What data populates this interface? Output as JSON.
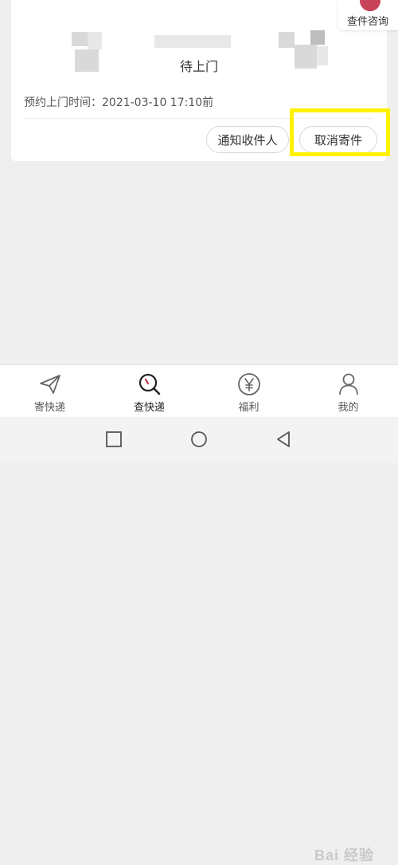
{
  "order": {
    "status": "待上门",
    "appointment": "预约上门时间：2021-03-10 17:10前"
  },
  "actions": {
    "notify_label": "通知收件人",
    "cancel_label": "取消寄件"
  },
  "consult": {
    "label": "查件咨询"
  },
  "tabs": [
    {
      "label": "寄快递",
      "icon": "paper-plane-icon",
      "active": false
    },
    {
      "label": "查快递",
      "icon": "magnifier-icon",
      "active": true
    },
    {
      "label": "福利",
      "icon": "yen-coin-icon",
      "active": false
    },
    {
      "label": "我的",
      "icon": "person-icon",
      "active": false
    }
  ],
  "system_nav": {
    "buttons": [
      "recent-apps-icon",
      "home-icon",
      "back-icon"
    ]
  },
  "watermark": {
    "text": "Bai 经验"
  },
  "colors": {
    "highlight": "#fff200",
    "accent_red": "#c8445a"
  }
}
